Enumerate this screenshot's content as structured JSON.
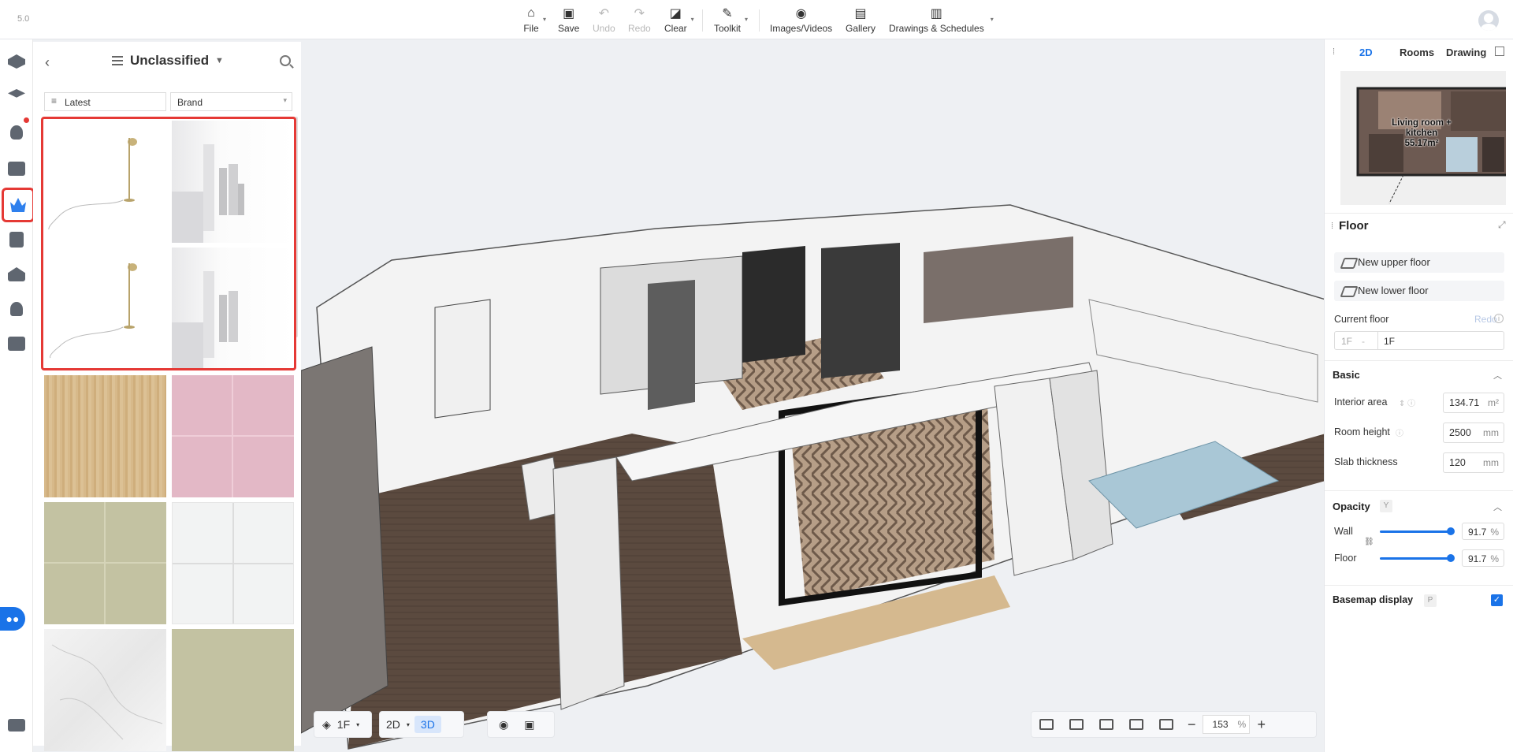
{
  "app": {
    "version": "5.0"
  },
  "toolbar": {
    "file": "File",
    "save": "Save",
    "undo": "Undo",
    "redo": "Redo",
    "clear": "Clear",
    "toolkit": "Toolkit",
    "images_videos": "Images/Videos",
    "gallery": "Gallery",
    "drawings": "Drawings & Schedules"
  },
  "catalog": {
    "title": "Unclassified",
    "sort": "Latest",
    "brand_placeholder": "Brand"
  },
  "bottom_left": {
    "floor": "1F",
    "view2d": "2D",
    "view3d": "3D"
  },
  "zoom": {
    "value": "153",
    "unit": "%"
  },
  "right_panel": {
    "tabs": [
      "2D",
      "Rooms",
      "Drawing"
    ],
    "minimap_label_line1": "Living room +",
    "minimap_label_line2": "kitchen",
    "minimap_label_line3": "55.17m²",
    "floor_title": "Floor",
    "new_upper": "New upper floor",
    "new_lower": "New lower floor",
    "current_floor_label": "Current floor",
    "redo_label": "Redo",
    "current_floor_short": "1F",
    "current_floor_value": "1F",
    "basic_title": "Basic",
    "interior_area_label": "Interior area",
    "interior_area_value": "134.71",
    "interior_area_unit": "m²",
    "room_height_label": "Room height",
    "room_height_value": "2500",
    "room_height_unit": "mm",
    "slab_label": "Slab thickness",
    "slab_value": "120",
    "slab_unit": "mm",
    "opacity_title": "Opacity",
    "opacity_key": "Y",
    "wall_label": "Wall",
    "wall_value": "91.7",
    "floor_label": "Floor",
    "floor_value": "91.7",
    "pct_unit": "%",
    "basemap_label": "Basemap display",
    "basemap_key": "P"
  },
  "colors": {
    "accent": "#1a73e8",
    "highlight": "#e53935"
  }
}
